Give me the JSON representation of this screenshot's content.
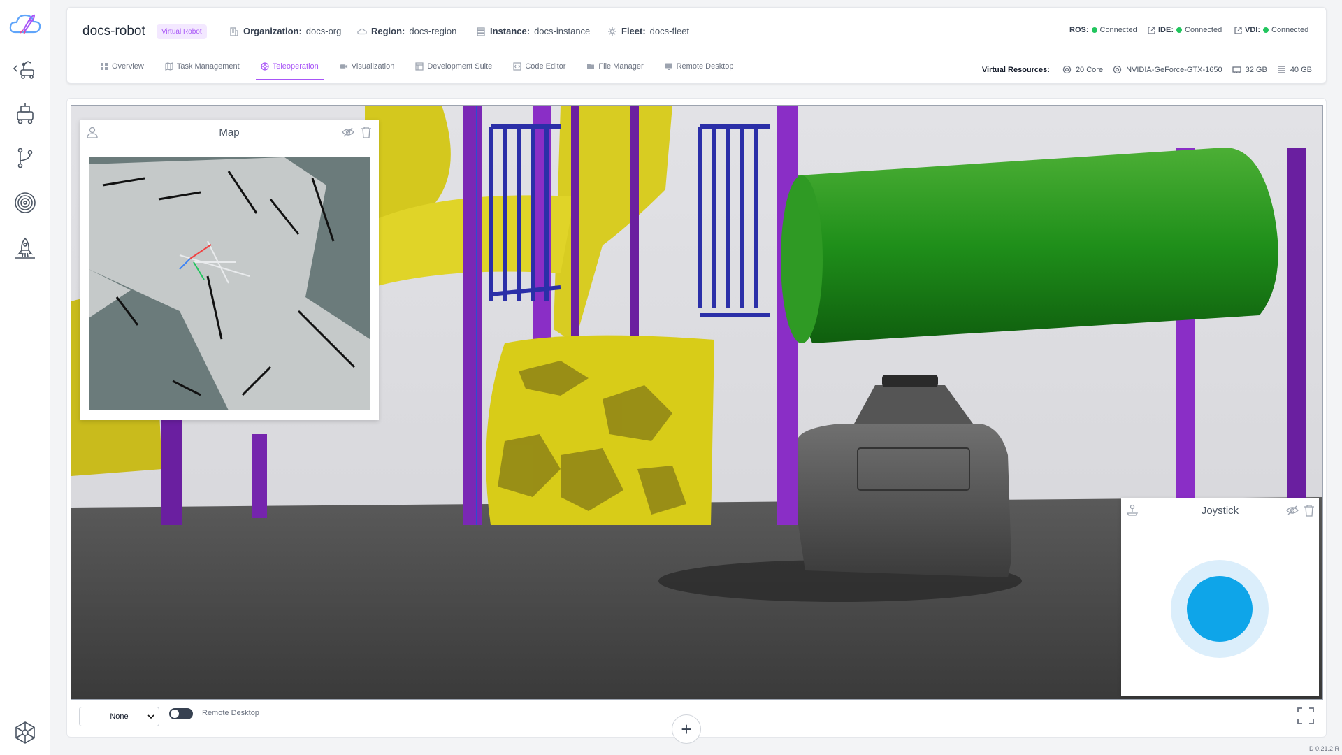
{
  "sidebar": {
    "logo_icon": "rocket-cloud-logo",
    "items": [
      {
        "name": "robots",
        "icon": "robot-arm-icon"
      },
      {
        "name": "fleets",
        "icon": "mobile-robot-icon"
      },
      {
        "name": "branches",
        "icon": "git-branch-icon"
      },
      {
        "name": "instances",
        "icon": "target-icon"
      },
      {
        "name": "deployments",
        "icon": "rocket-launch-icon"
      }
    ],
    "bottom_icon": "hex-network-icon"
  },
  "header": {
    "robot_name": "docs-robot",
    "badge": "Virtual Robot",
    "organization_label": "Organization:",
    "organization": "docs-org",
    "region_label": "Region:",
    "region": "docs-region",
    "instance_label": "Instance:",
    "instance": "docs-instance",
    "fleet_label": "Fleet:",
    "fleet": "docs-fleet",
    "status": {
      "ros_label": "ROS:",
      "ros": "Connected",
      "ide_label": "IDE:",
      "ide": "Connected",
      "vdi_label": "VDI:",
      "vdi": "Connected"
    },
    "tabs": [
      {
        "label": "Overview"
      },
      {
        "label": "Task Management"
      },
      {
        "label": "Teleoperation"
      },
      {
        "label": "Visualization"
      },
      {
        "label": "Development Suite"
      },
      {
        "label": "Code Editor"
      },
      {
        "label": "File Manager"
      },
      {
        "label": "Remote Desktop"
      }
    ],
    "active_tab": "Teleoperation",
    "resources": {
      "label": "Virtual Resources:",
      "cpu": "20 Core",
      "gpu": "NVIDIA-GeForce-GTX-1650",
      "memory": "32 GB",
      "storage": "40 GB"
    }
  },
  "widgets": {
    "map": {
      "title": "Map"
    },
    "joystick": {
      "title": "Joystick"
    }
  },
  "bottom": {
    "select_value": "None",
    "toggle_label": "Remote Desktop",
    "version": "D 0.21.2 R"
  },
  "colors": {
    "accent": "#a855f7",
    "status_ok": "#22c55e",
    "joystick": "#0ea5e9"
  }
}
